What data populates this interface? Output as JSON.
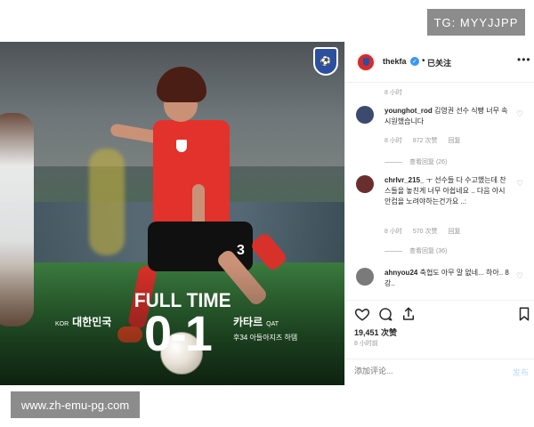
{
  "watermarks": {
    "top_right": "TG: MYYJJPP",
    "bottom_left": "www.zh-emu-pg.com"
  },
  "photo": {
    "overlay": {
      "headline": "FULL TIME",
      "score": "0-1",
      "home_code": "KOR",
      "home_name": "대한민국",
      "away_name": "카타르",
      "away_code": "QAT",
      "goal_note": "후34 아들아지즈 하템"
    },
    "jersey_number": "3"
  },
  "header": {
    "username": "thekfa",
    "verified": true,
    "separator": "•",
    "follow_status": "已关注",
    "more": "•••"
  },
  "comments": {
    "first_time": "8 小时",
    "items": [
      {
        "user": "younghot_rod",
        "text": "김영권 선수 식빵 너무 속시원했습니다",
        "time": "8 小时",
        "likes": "872 次赞",
        "reply": "回复",
        "view_replies": "查看回复 (26)",
        "avatar_color": "#3c4a6e"
      },
      {
        "user": "chrlvr_215_",
        "text": "ㅜ 선수들 다 수고했는데 찬스들을 놓친게 너무 아쉽네요 .. 다음 아시안컵을 노려야하는건가요 ..:",
        "time": "8 小时",
        "likes": "570 次赞",
        "reply": "回复",
        "view_replies": "查看回复 (36)",
        "avatar_color": "#6a2e2e"
      },
      {
        "user": "ahnyou24",
        "text": "축협도 아무 말 없네... 하아.. 8강..",
        "time": "",
        "likes": "",
        "reply": "",
        "view_replies": "",
        "avatar_color": "#7a7a7a"
      }
    ]
  },
  "actions": {
    "likes": "19,451 次赞",
    "time": "8 小时前",
    "icons": [
      "heart-icon",
      "comment-icon",
      "share-icon",
      "bookmark-icon"
    ]
  },
  "add_comment": {
    "placeholder": "添加评论...",
    "post_label": "发布"
  },
  "colors": {
    "accent_link": "#3897f0",
    "jersey_red": "#e3322b"
  }
}
